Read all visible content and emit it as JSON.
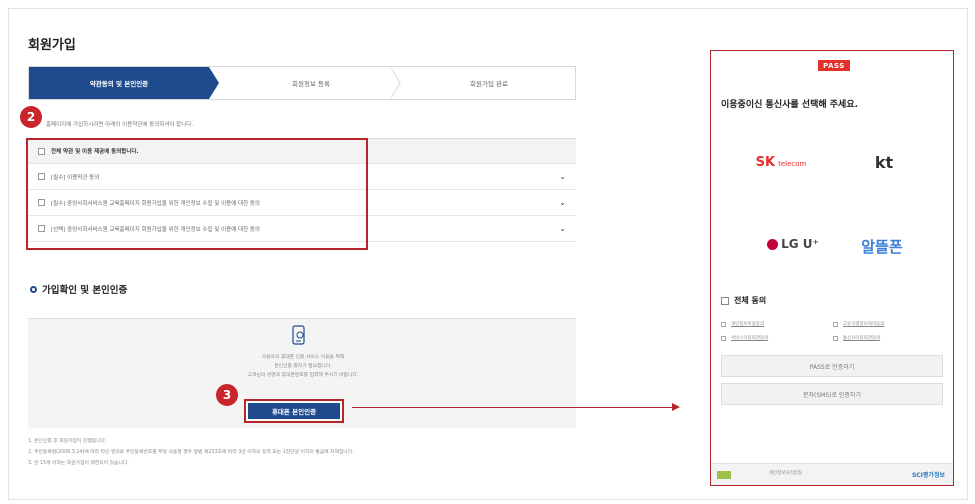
{
  "page": {
    "title": "회원가입"
  },
  "stepper": {
    "steps": [
      "약관동의 및 본인인증",
      "회원정보 등록",
      "회원가입 완료"
    ]
  },
  "badges": [
    "2",
    "3"
  ],
  "agreement": {
    "intro": "홈페이지에 가입하시려면 아래의 이용약관에 동의하셔야 합니다.",
    "all_label": "전체 약관 및 이용 제공에 동의합니다.",
    "items": [
      "[필수] 이용약관 동의",
      "[필수] 중앙사회서비스원 교육홈페이지 회원가입을 위한 개인정보 수집 및 이용에 대한 동의",
      "[선택] 중앙사회서비스원 교육홈페이지 회원가입을 위한 개인정보 수집 및 이용에 대한 동의"
    ]
  },
  "verify": {
    "section_title": "가입확인 및 본인인증",
    "text_lines": [
      "사용자의 휴대폰 인증 서비스 이용을 위해",
      "본인인증 절차가 필요합니다.",
      "고객님의 성명과 휴대폰번호를 입력해 주시기 바랍니다."
    ],
    "button_label": "휴대폰 본인인증"
  },
  "notes": [
    "1. 본인인증 후 회원가입이 진행됩니다.",
    "2. 주민등록법(2006.3.24)에 따라 타인 명의로 주민등록번호를 부정 사용할 경우 형법 제233조에 따라 3년 이하의 징역 또는 1천만원 이하의 벌금에 처해집니다.",
    "3. 만 15세 이하는 회원가입이 제한되어 있습니다."
  ],
  "pass": {
    "logo": "PASS",
    "title": "이용중이신 통신사를 선택해 주세요.",
    "carriers": {
      "skt_main": "SK",
      "skt_sub": "telecom",
      "kt": "kt",
      "lgu": "LG U⁺",
      "alddle": "알뜰폰"
    },
    "all_agree": "전체 동의",
    "sub_agrees": [
      "개인정보이용동의",
      "고유식별정보처리동의",
      "서비스이용약관동의",
      "통신사이용약관동의"
    ],
    "buttons": [
      "PASS로 인증하기",
      "문자(SMS)로 인증하기"
    ],
    "footer": {
      "mid": "개인정보처리방침",
      "sci": "SCI평가정보"
    }
  },
  "colors": {
    "accent_blue": "#1e4b8e",
    "highlight_red": "#b5262c",
    "pass_red": "#e4322b"
  }
}
